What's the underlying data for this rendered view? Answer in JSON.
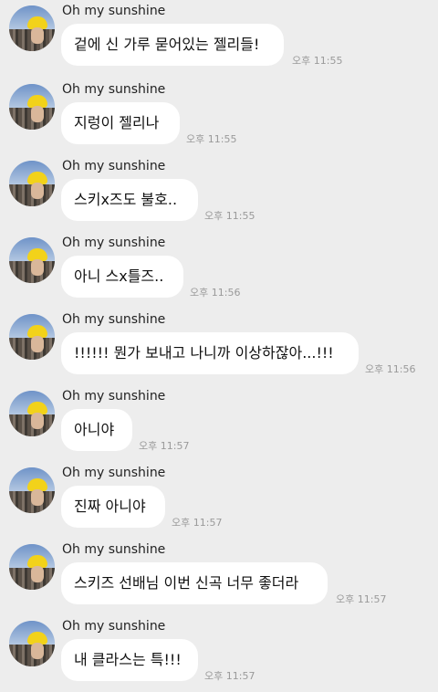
{
  "chat": {
    "messages": [
      {
        "sender": "Oh my sunshine",
        "text": "겉에 신 가루 묻어있는 젤리들!",
        "time": "오후 11:55"
      },
      {
        "sender": "Oh my sunshine",
        "text": "지렁이 젤리나",
        "time": "오후 11:55"
      },
      {
        "sender": "Oh my sunshine",
        "text": "스키x즈도 불호..",
        "time": "오후 11:55"
      },
      {
        "sender": "Oh my sunshine",
        "text": "아니 스x틀즈..",
        "time": "오후 11:56"
      },
      {
        "sender": "Oh my sunshine",
        "text": "!!!!!! 뭔가 보내고 나니까 이상하잖아...!!!",
        "time": "오후 11:56"
      },
      {
        "sender": "Oh my sunshine",
        "text": "아니야",
        "time": "오후 11:57"
      },
      {
        "sender": "Oh my sunshine",
        "text": "진짜 아니야",
        "time": "오후 11:57"
      },
      {
        "sender": "Oh my sunshine",
        "text": "스키즈 선배님 이번 신곡 너무 좋더라",
        "time": "오후 11:57"
      },
      {
        "sender": "Oh my sunshine",
        "text": "내 클라스는 특!!!",
        "time": "오후 11:57"
      }
    ]
  }
}
